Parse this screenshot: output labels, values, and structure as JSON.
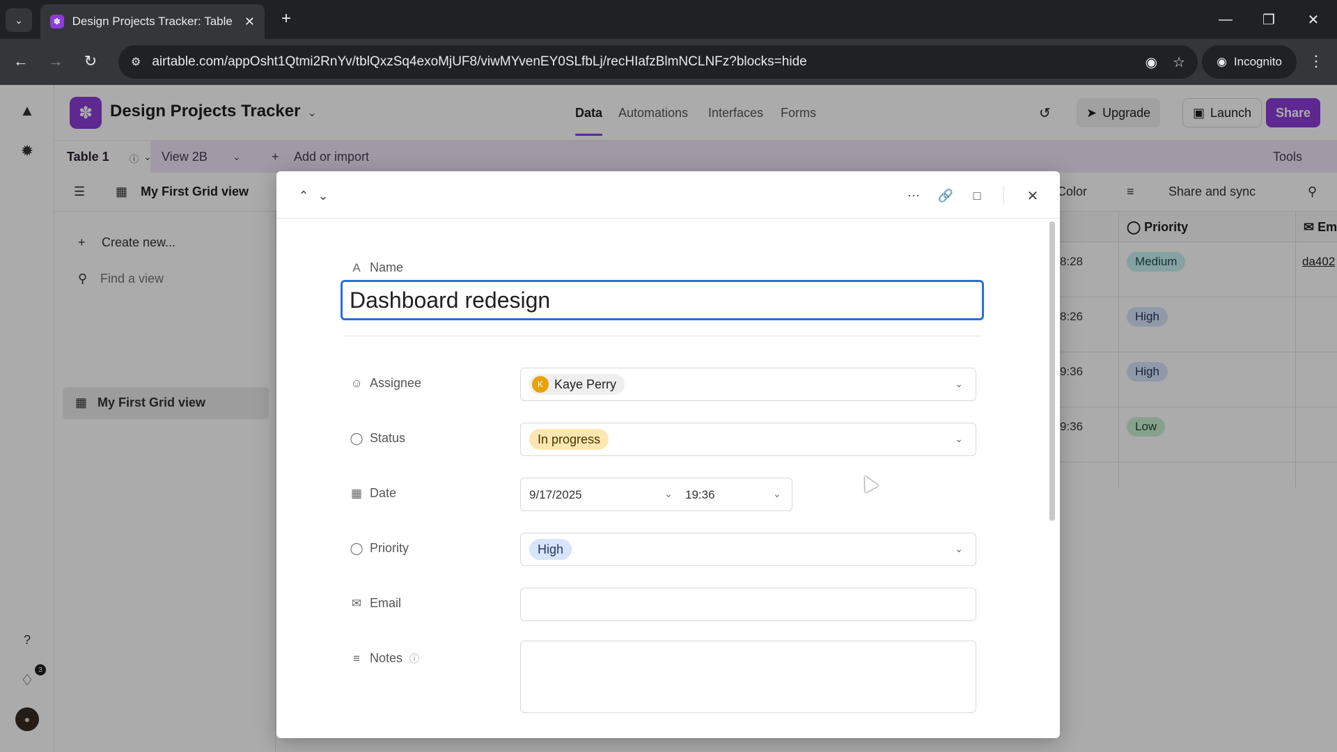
{
  "browser": {
    "tab_title": "Design Projects Tracker: Table 1",
    "url": "airtable.com/appOsht1Qtmi2RnYv/tblQxzSq4exoMjUF8/viwMYvenEY0SLfbLj/recHIafzBlmNCLNFz?blocks=hide",
    "incognito_label": "Incognito"
  },
  "app": {
    "title": "Design Projects Tracker",
    "nav": {
      "data": "Data",
      "automations": "Automations",
      "interfaces": "Interfaces",
      "forms": "Forms"
    },
    "upgrade": "Upgrade",
    "launch": "Launch",
    "share": "Share",
    "notification_count": "3"
  },
  "tablebar": {
    "table": "Table 1",
    "view": "View 2B",
    "add": "Add or import",
    "tools": "Tools"
  },
  "viewbar": {
    "view_name": "My First Grid view",
    "color": "Color",
    "share_sync": "Share and sync"
  },
  "sidebar": {
    "create": "Create new...",
    "find": "Find a view",
    "view_item": "My First Grid view"
  },
  "grid": {
    "priority_header": "Priority",
    "email_header": "Em",
    "rows": [
      {
        "time": "8:28",
        "priority": "Medium",
        "email": "da402"
      },
      {
        "time": "8:26",
        "priority": "High",
        "email": ""
      },
      {
        "time": "9:36",
        "priority": "High",
        "email": ""
      },
      {
        "time": "9:36",
        "priority": "Low",
        "email": ""
      }
    ]
  },
  "record": {
    "labels": {
      "name": "Name",
      "assignee": "Assignee",
      "status": "Status",
      "date": "Date",
      "priority": "Priority",
      "email": "Email",
      "notes": "Notes"
    },
    "name": "Dashboard redesign",
    "assignee": "Kaye Perry",
    "assignee_initial": "K",
    "status": "In progress",
    "date": "9/17/2025",
    "time": "19:36",
    "priority": "High",
    "email": "",
    "notes": ""
  },
  "colors": {
    "brand": "#8b3dd6",
    "focus": "#2b6fd6"
  }
}
